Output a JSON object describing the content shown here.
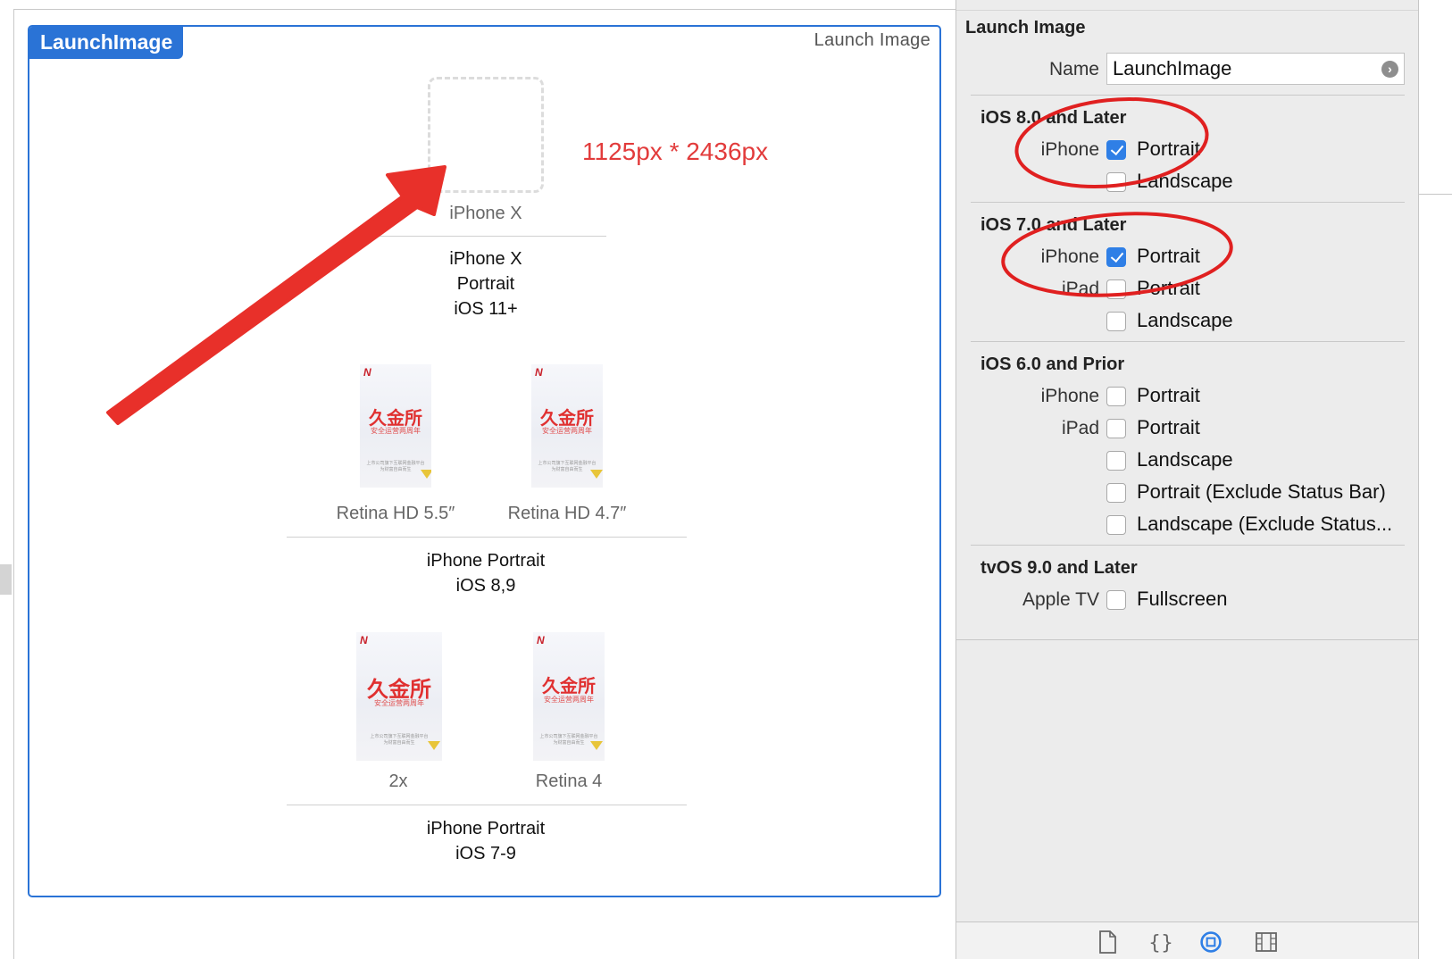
{
  "asset": {
    "title": "LaunchImage",
    "type": "Launch Image"
  },
  "slots": {
    "iphonex_slot_label": "iPhone X",
    "iphonex_group": [
      "iPhone X",
      "Portrait",
      "iOS 11+"
    ],
    "retina55_label": "Retina HD 5.5″",
    "retina47_label": "Retina HD 4.7″",
    "ios89_group": [
      "iPhone Portrait",
      "iOS 8,9"
    ],
    "twox_label": "2x",
    "retina4_label": "Retina 4",
    "ios79_group": [
      "iPhone Portrait",
      "iOS 7-9"
    ]
  },
  "thumbnail": {
    "logo": "久金所",
    "tagline": "安全运营两周年",
    "fine_print_1": "上市公司旗下互联网金融平台",
    "fine_print_2": "为财富自由而生"
  },
  "annotation": {
    "size_note": "1125px * 2436px",
    "color": "#e8302a"
  },
  "inspector": {
    "title": "Launch Image",
    "name_label": "Name",
    "name_value": "LaunchImage",
    "sections": [
      {
        "title": "iOS 8.0 and Later",
        "rows": [
          {
            "device": "iPhone",
            "option": "Portrait",
            "checked": true
          },
          {
            "device": "",
            "option": "Landscape",
            "checked": false
          }
        ]
      },
      {
        "title": "iOS 7.0 and Later",
        "rows": [
          {
            "device": "iPhone",
            "option": "Portrait",
            "checked": true
          },
          {
            "device": "iPad",
            "option": "Portrait",
            "checked": false
          },
          {
            "device": "",
            "option": "Landscape",
            "checked": false
          }
        ]
      },
      {
        "title": "iOS 6.0 and Prior",
        "rows": [
          {
            "device": "iPhone",
            "option": "Portrait",
            "checked": false
          },
          {
            "device": "iPad",
            "option": "Portrait",
            "checked": false
          },
          {
            "device": "",
            "option": "Landscape",
            "checked": false
          },
          {
            "device": "",
            "option": "Portrait (Exclude Status Bar)",
            "checked": false
          },
          {
            "device": "",
            "option": "Landscape (Exclude Status...",
            "checked": false
          }
        ]
      },
      {
        "title": "tvOS 9.0 and Later",
        "rows": [
          {
            "device": "Apple TV",
            "option": "Fullscreen",
            "checked": false
          }
        ]
      }
    ],
    "toolbar_icons": [
      "file-inspector-icon",
      "quick-help-icon",
      "attributes-inspector-icon",
      "size-inspector-icon"
    ],
    "accent": "#2f7fe6"
  }
}
